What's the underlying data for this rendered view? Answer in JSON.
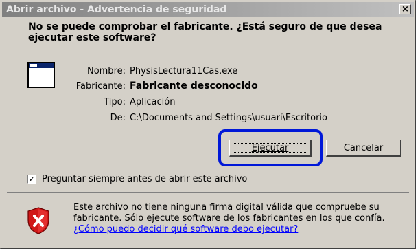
{
  "dialog": {
    "title": "Abrir archivo - Advertencia de seguridad",
    "close_glyph": "×",
    "question": "No se puede comprobar el fabricante. ¿Está seguro de que desea ejecutar este software?",
    "details": {
      "name_label": "Nombre:",
      "name_value": "PhysisLectura11Cas.exe",
      "publisher_label": "Fabricante:",
      "publisher_value": "Fabricante desconocido",
      "type_label": "Tipo:",
      "type_value": "Aplicación",
      "from_label": "De:",
      "from_value": "C:\\Documents and Settings\\usuari\\Escritorio"
    },
    "buttons": {
      "run": "Ejecutar",
      "cancel": "Cancelar"
    },
    "checkbox": {
      "label": "Preguntar siempre antes de abrir este archivo",
      "checked": true,
      "mark": "✓"
    },
    "warning": {
      "text": "Este archivo no tiene ninguna firma digital válida que compruebe su fabricante.  Sólo ejecute software de los fabricantes en los que confía.",
      "link": "¿Cómo puedo decidir qué software debo ejecutar?"
    },
    "colors": {
      "highlight": "#0018d8",
      "shield_red": "#d01818",
      "link": "#0000ff"
    },
    "icons": {
      "app": "application-window-icon",
      "shield": "security-shield-icon"
    }
  }
}
